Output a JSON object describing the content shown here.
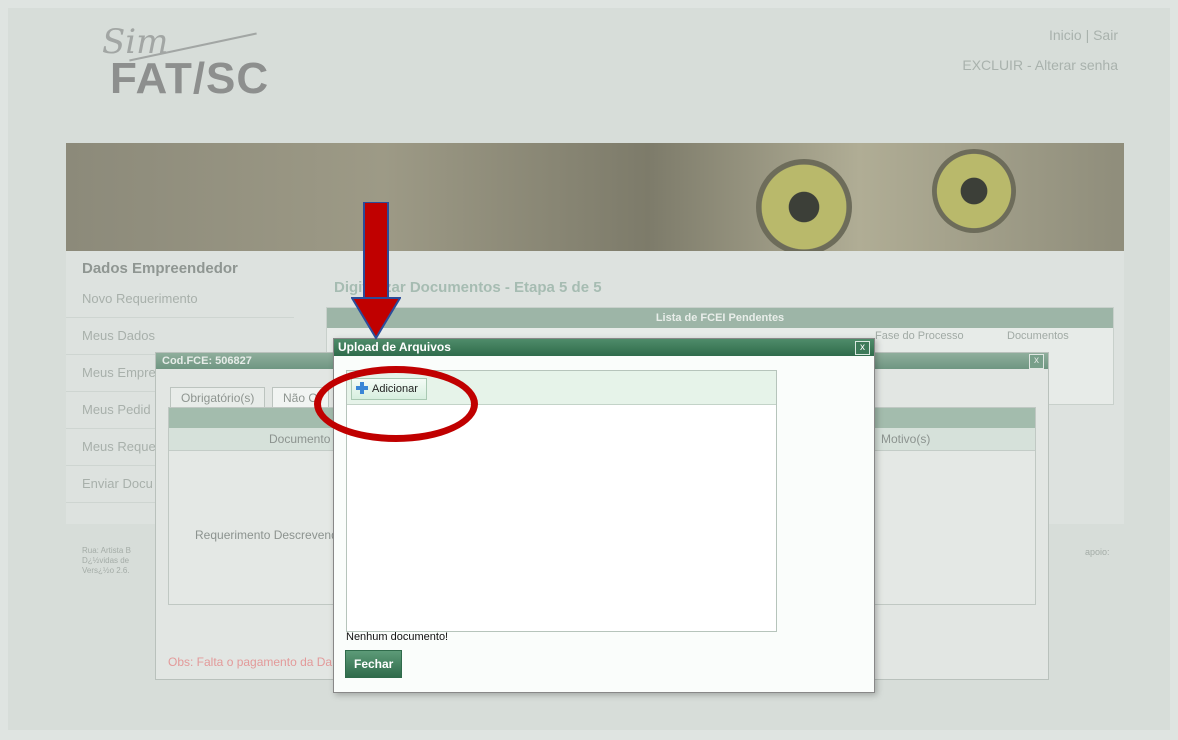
{
  "header": {
    "logo_script": "Sim",
    "logo_text": "FAT/SC",
    "nav_top": "Inicio | Sair",
    "nav_bottom": "EXCLUIR - Alterar senha"
  },
  "sidebar": {
    "title": "Dados Empreendedor",
    "items": [
      {
        "label": "Novo Requerimento"
      },
      {
        "label": "Meus Dados"
      },
      {
        "label": "Meus Empre"
      },
      {
        "label": "Meus Pedid"
      },
      {
        "label": "Meus Reque"
      },
      {
        "label": "Enviar Docu"
      }
    ]
  },
  "main": {
    "title": "Digitalizar Documentos - Etapa 5 de 5",
    "pending_table": {
      "header": "Lista de FCEI Pendentes",
      "columns": [
        "Fase do Processo",
        "Documentos"
      ]
    }
  },
  "footer": {
    "line1": "Rua: Artista B",
    "line2": "D¿½vidas de",
    "line3": "Vers¿½o 2.6.",
    "apoio": "apoio:"
  },
  "fce_dialog": {
    "title": "Cod.FCE: 506827",
    "close": "x",
    "tabs": [
      "Obrigatório(s)",
      "Não O"
    ],
    "columns": [
      "Documento",
      "Motivo(s)"
    ],
    "row_text": "Requerimento Descrevend",
    "obs": "Obs: Falta o pagamento da Da"
  },
  "upload_dialog": {
    "title": "Upload de Arquivos",
    "close": "x",
    "add_label": "Adicionar",
    "empty_message": "Nenhum documento!",
    "close_button": "Fechar"
  },
  "colors": {
    "accent": "#2f6b4b",
    "annotation": "#c00000"
  }
}
